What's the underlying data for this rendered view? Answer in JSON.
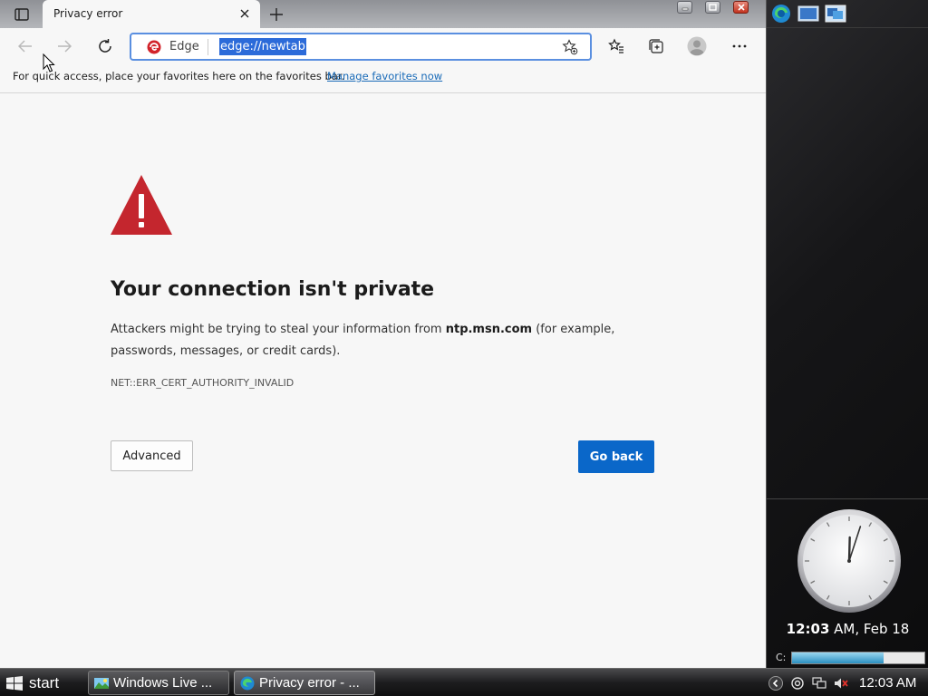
{
  "browser": {
    "tab": {
      "title": "Privacy error"
    },
    "omnibox": {
      "site_label": "Edge",
      "url": "edge://newtab"
    },
    "favorites_bar": {
      "message": "For quick access, place your favorites here on the favorites bar.",
      "link": "Manage favorites now"
    },
    "error": {
      "title": "Your connection isn't private",
      "description_before": "Attackers might be trying to steal your information from ",
      "host": "ntp.msn.com",
      "description_after": " (for example, passwords, messages, or credit cards).",
      "code": "NET::ERR_CERT_AUTHORITY_INVALID",
      "advanced_label": "Advanced",
      "go_back_label": "Go back"
    },
    "colors": {
      "warning": "#c4262e",
      "primary_button": "#0a67c9",
      "link": "#1a6bb8"
    }
  },
  "sidebar": {
    "clock": {
      "time_bold": "12:03",
      "time_rest": " AM, Feb 18",
      "hour": 12,
      "minute": 3
    },
    "drive": {
      "label": "C:",
      "used_fraction": 0.69
    }
  },
  "taskbar": {
    "start_label": "start",
    "tasks": [
      {
        "label": "Windows Live ..."
      },
      {
        "label": "Privacy error - ..."
      }
    ],
    "tray_time": "12:03 AM"
  }
}
